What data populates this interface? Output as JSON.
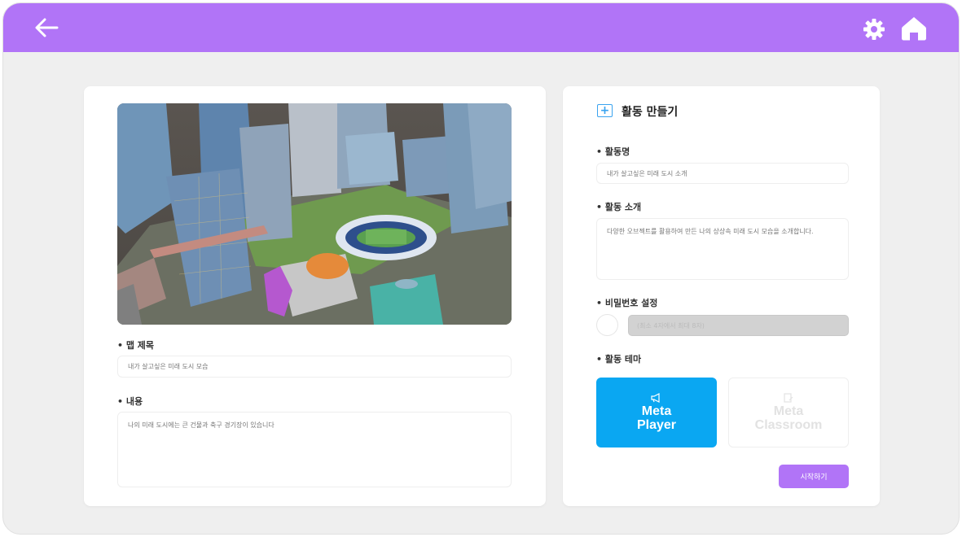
{
  "colors": {
    "topbar": "#b174f7",
    "accent_blue": "#0aa7f2",
    "start_button": "#b174f7"
  },
  "header": {
    "back_icon": "arrow-left-icon",
    "settings_icon": "gear-icon",
    "home_icon": "home-icon"
  },
  "map_panel": {
    "image": "3d-city-map-preview",
    "map_title_label": "• 맵 제목",
    "map_title_value": "내가 살고싶은 미래 도시 모습",
    "content_label": "• 내용",
    "content_value": "나의 미래 도시에는 큰 건물과 축구 경기장이 있습니다"
  },
  "activity_panel": {
    "title": "활동 만들기",
    "title_icon": "plus-square-icon",
    "activity_name_label": "• 활동명",
    "activity_name_value": "내가 살고싶은 미래 도시 소개",
    "activity_intro_label": "• 활동 소개",
    "activity_intro_value": "다양한 오브젝트를 활용하여 만든 나의 상상속 미래 도시 모습을 소개합니다.",
    "password_label": "• 비밀번호 설정",
    "password_placeholder": "(최소 4자에서 최대 8자)",
    "theme_label": "• 활동 테마",
    "theme_options": [
      {
        "label_line1": "Meta",
        "label_line2": "Player",
        "icon": "megaphone-icon",
        "selected": true
      },
      {
        "label_line1": "Meta",
        "label_line2": "Classroom",
        "icon": "edit-doc-icon",
        "selected": false
      }
    ],
    "start_button": "시작하기"
  }
}
